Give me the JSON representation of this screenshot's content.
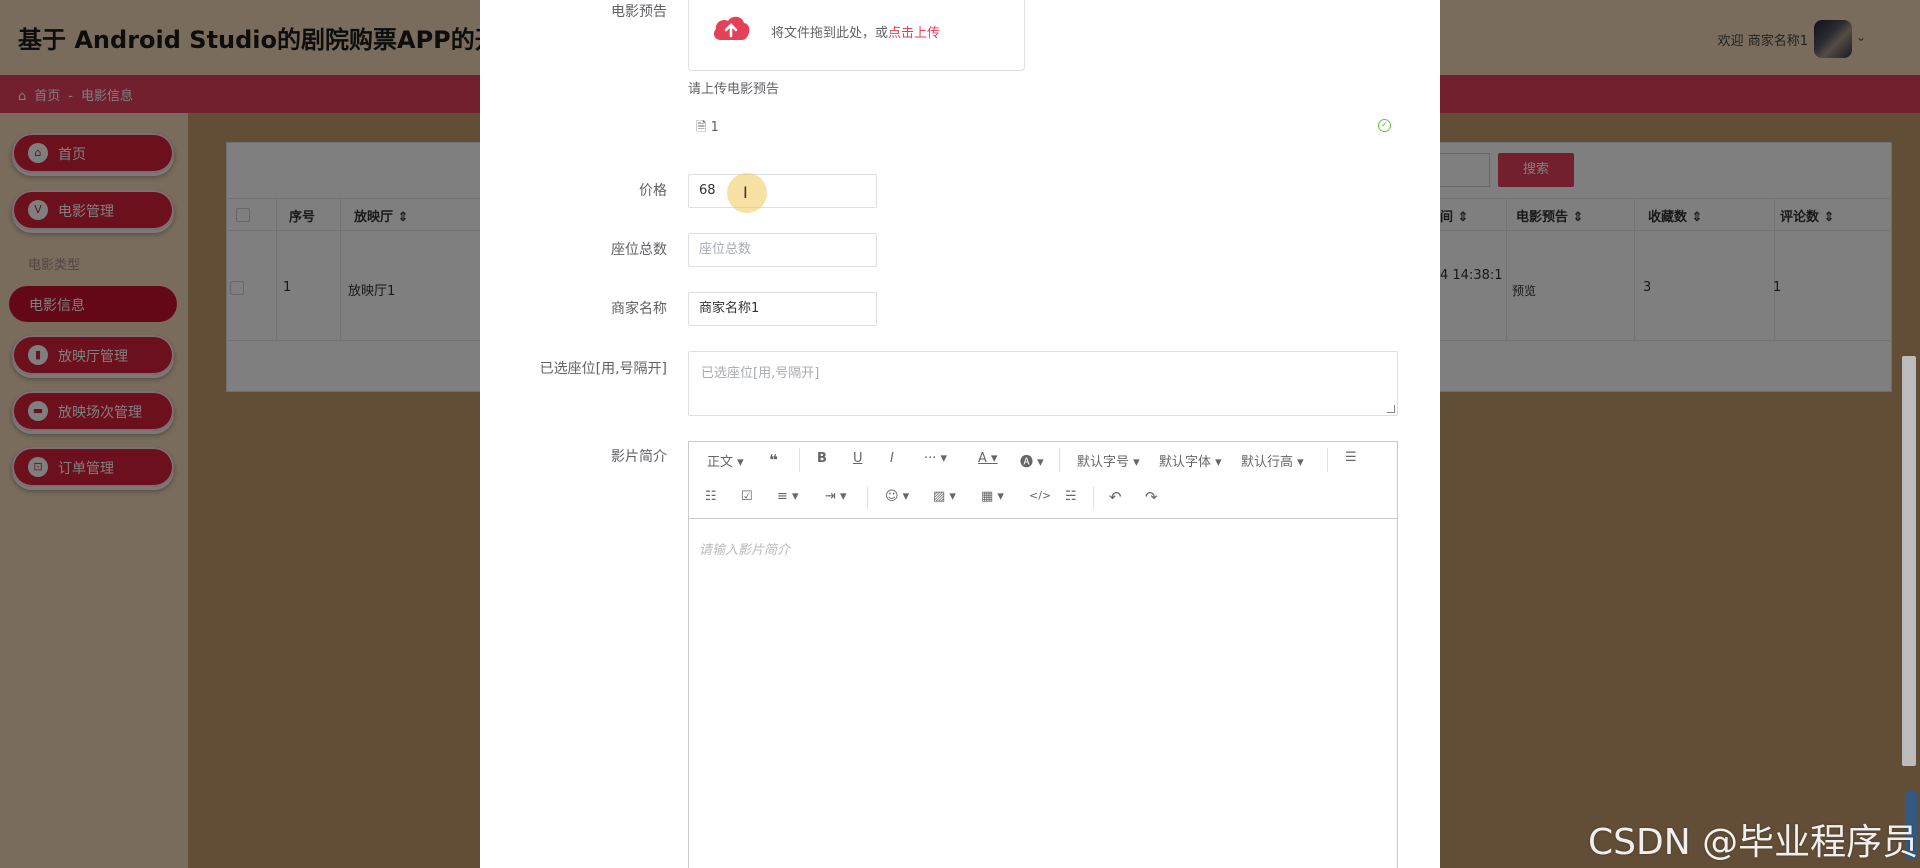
{
  "app": {
    "title": "基于 Android Studio的剧院购票APP的开发与",
    "welcome": "欢迎 商家名称1"
  },
  "breadcrumb": {
    "home": "首页",
    "separator": "-",
    "current": "电影信息"
  },
  "sidebar": {
    "items": [
      {
        "label": "首页",
        "icon": "home-icon"
      },
      {
        "label": "电影管理",
        "icon": "vip-icon"
      },
      {
        "label": "放映厅管理",
        "icon": "book-icon"
      },
      {
        "label": "放映场次管理",
        "icon": "ticket-icon"
      },
      {
        "label": "订单管理",
        "icon": "cart-icon"
      }
    ],
    "submenu": {
      "label": "电影类型",
      "active": "电影信息"
    }
  },
  "table": {
    "search_button": "搜索",
    "headers": {
      "index": "序号",
      "hall": "放映厅",
      "time": "间",
      "preview": "电影预告",
      "favorites": "收藏数",
      "comments": "评论数"
    },
    "row": {
      "index": "1",
      "hall": "放映厅1",
      "time": "4 14:38:1",
      "preview": "预览",
      "favorites": "3",
      "comments": "1"
    }
  },
  "form": {
    "preview": {
      "label": "电影预告",
      "drop_text": "将文件拖到此处，或",
      "click_upload": "点击上传",
      "tip": "请上传电影预告",
      "file_name": "1"
    },
    "price": {
      "label": "价格",
      "value": "68"
    },
    "seat_total": {
      "label": "座位总数",
      "placeholder": "座位总数"
    },
    "merchant": {
      "label": "商家名称",
      "value": "商家名称1"
    },
    "selected_seats": {
      "label": "已选座位[用,号隔开]",
      "placeholder": "已选座位[用,号隔开]"
    },
    "intro": {
      "label": "影片简介",
      "placeholder": "请输入影片简介",
      "toolbar": {
        "paragraph": "正文",
        "font_size": "默认字号",
        "font_family": "默认字体",
        "line_height": "默认行高"
      }
    }
  },
  "watermark": "CSDN @毕业程序员",
  "colors": {
    "accent": "#e5405a",
    "sidebar_button": "#d8203a",
    "success": "#67c23a"
  }
}
